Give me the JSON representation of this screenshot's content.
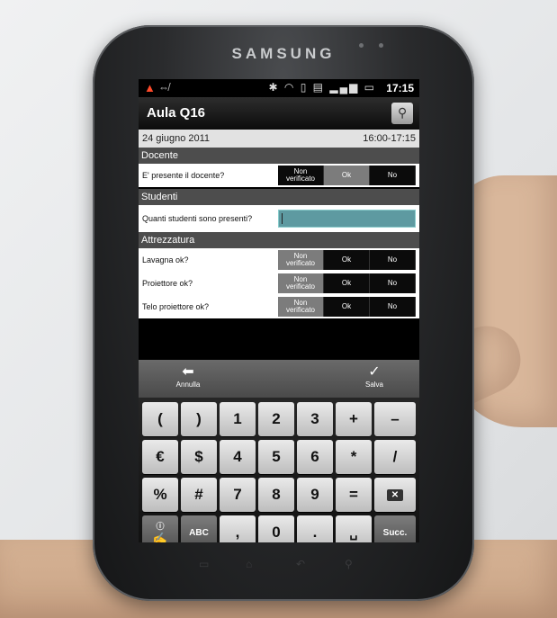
{
  "device": {
    "brand": "SAMSUNG"
  },
  "status_bar": {
    "time": "17:15",
    "icons": [
      "warning-icon",
      "usb-icon",
      "bluetooth-icon",
      "wifi-icon",
      "vibrate-icon",
      "sd-icon",
      "signal-icon",
      "battery-icon"
    ]
  },
  "app": {
    "title": "Aula Q16"
  },
  "header": {
    "date": "24 giugno 2011",
    "time_range": "16:00-17:15"
  },
  "sections": {
    "docente": {
      "label": "Docente",
      "question": "E' presente il docente?"
    },
    "studenti": {
      "label": "Studenti",
      "question": "Quanti studenti sono presenti?",
      "value": ""
    },
    "attrezzatura": {
      "label": "Attrezzatura",
      "questions": [
        "Lavagna ok?",
        "Proiettore ok?",
        "Telo proiettore ok?"
      ]
    }
  },
  "options": {
    "non_line1": "Non",
    "non_line2": "verificato",
    "ok": "Ok",
    "no": "No"
  },
  "actions": {
    "cancel": "Annulla",
    "save": "Salva"
  },
  "keyboard": {
    "row1": [
      "(",
      ")",
      "1",
      "2",
      "3",
      "+",
      "–"
    ],
    "row2": [
      "€",
      "$",
      "4",
      "5",
      "6",
      "*",
      "/"
    ],
    "row3": [
      "%",
      "#",
      "7",
      "8",
      "9",
      "="
    ],
    "row4": [
      "ABC",
      ",",
      "0",
      ".",
      "Succ."
    ]
  },
  "colors": {
    "input_fill": "#5e9aa1",
    "section_bg": "#4d4d4d",
    "selected_option": "#7c7c7c"
  }
}
